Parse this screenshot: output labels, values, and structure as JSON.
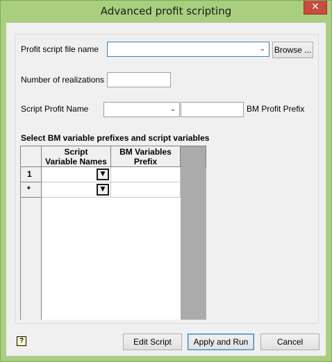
{
  "window": {
    "title": "Advanced profit scripting",
    "close_glyph": "✕"
  },
  "form": {
    "profit_script_label": "Profit script file name",
    "profit_script_value": "",
    "browse_label": "Browse ...",
    "realizations_label": "Number of realizations",
    "realizations_value": "",
    "script_profit_name_label": "Script Profit Name",
    "script_profit_name_value": "",
    "bm_profit_prefix_value": "",
    "bm_profit_prefix_label": "BM Profit Prefix"
  },
  "grid": {
    "title": "Select BM variable prefixes and script variables",
    "columns": [
      "Script\nVariable Names",
      "BM Variables\nPrefix"
    ],
    "rows": [
      {
        "header": "1",
        "script_variable": "",
        "bm_prefix": ""
      },
      {
        "header": "*",
        "script_variable": "",
        "bm_prefix": ""
      }
    ],
    "dropdown_glyph": "▼"
  },
  "footer": {
    "help_glyph": "?",
    "edit_script_label": "Edit Script",
    "apply_run_label": "Apply and Run",
    "cancel_label": "Cancel"
  },
  "icons": {
    "combo_arrow": "⌄"
  }
}
